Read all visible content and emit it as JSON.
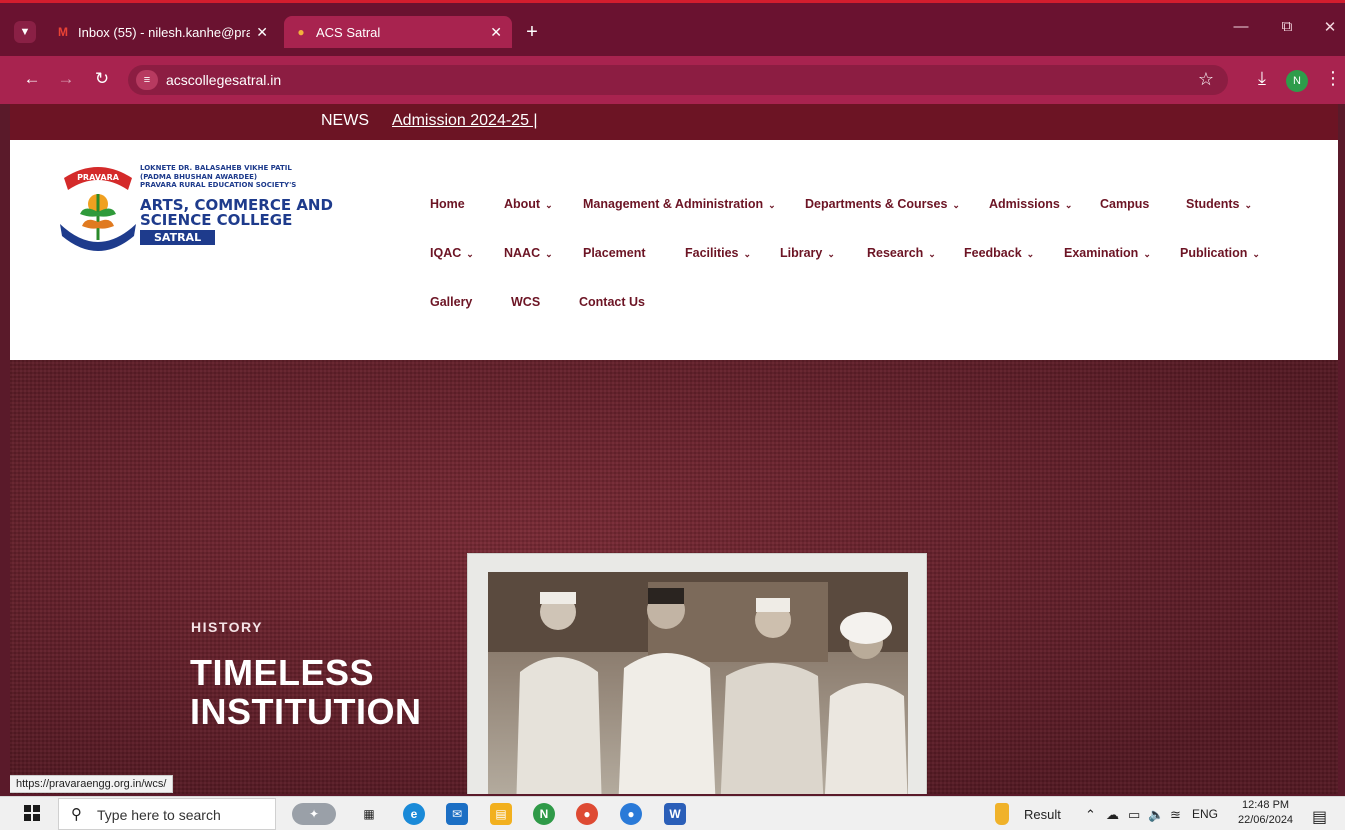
{
  "browser": {
    "tabs": [
      {
        "title": "Inbox (55) - nilesh.kanhe@prava",
        "favicon": "gmail-icon",
        "active": false
      },
      {
        "title": "ACS Satral",
        "favicon": "site-logo-icon",
        "active": true
      }
    ],
    "url": "acscollegesatral.in",
    "profile_initial": "N",
    "status_url": "https://pravaraengg.org.in/wcs/"
  },
  "news": {
    "label": "NEWS",
    "ticker": "Admission 2024-25 |"
  },
  "logo": {
    "emblem_text": "PRAVARA",
    "line1": "LOKNETE DR. BALASAHEB VIKHE PATIL",
    "line2": "(PADMA BHUSHAN AWARDEE)",
    "line3": "PRAVARA RURAL EDUCATION SOCIETY'S",
    "line4": "ARTS, COMMERCE AND",
    "line5": "SCIENCE COLLEGE",
    "tag": "SATRAL"
  },
  "nav": {
    "items": [
      {
        "label": "Home",
        "dropdown": false
      },
      {
        "label": "About",
        "dropdown": true
      },
      {
        "label": "Management & Administration",
        "dropdown": true
      },
      {
        "label": "Departments & Courses",
        "dropdown": true
      },
      {
        "label": "Admissions",
        "dropdown": true
      },
      {
        "label": "Campus",
        "dropdown": false
      },
      {
        "label": "Students",
        "dropdown": true
      },
      {
        "label": "IQAC",
        "dropdown": true
      },
      {
        "label": "NAAC",
        "dropdown": true
      },
      {
        "label": "Placement",
        "dropdown": false
      },
      {
        "label": "Facilities",
        "dropdown": true
      },
      {
        "label": "Library",
        "dropdown": true
      },
      {
        "label": "Research",
        "dropdown": true
      },
      {
        "label": "Feedback",
        "dropdown": true
      },
      {
        "label": "Examination",
        "dropdown": true
      },
      {
        "label": "Publication",
        "dropdown": true
      },
      {
        "label": "Gallery",
        "dropdown": false
      },
      {
        "label": "WCS",
        "dropdown": false
      },
      {
        "label": "Contact Us",
        "dropdown": false
      }
    ]
  },
  "hero": {
    "kicker": "HISTORY",
    "title_line1": "TIMELESS",
    "title_line2": "INSTITUTION"
  },
  "taskbar": {
    "search_placeholder": "Type here to search",
    "result_label": "Result",
    "language": "ENG",
    "time": "12:48 PM",
    "date": "22/06/2024"
  },
  "colors": {
    "brand_maroon": "#6c1424",
    "logo_blue": "#1e3b8c",
    "browser_accent": "#a8234f"
  }
}
